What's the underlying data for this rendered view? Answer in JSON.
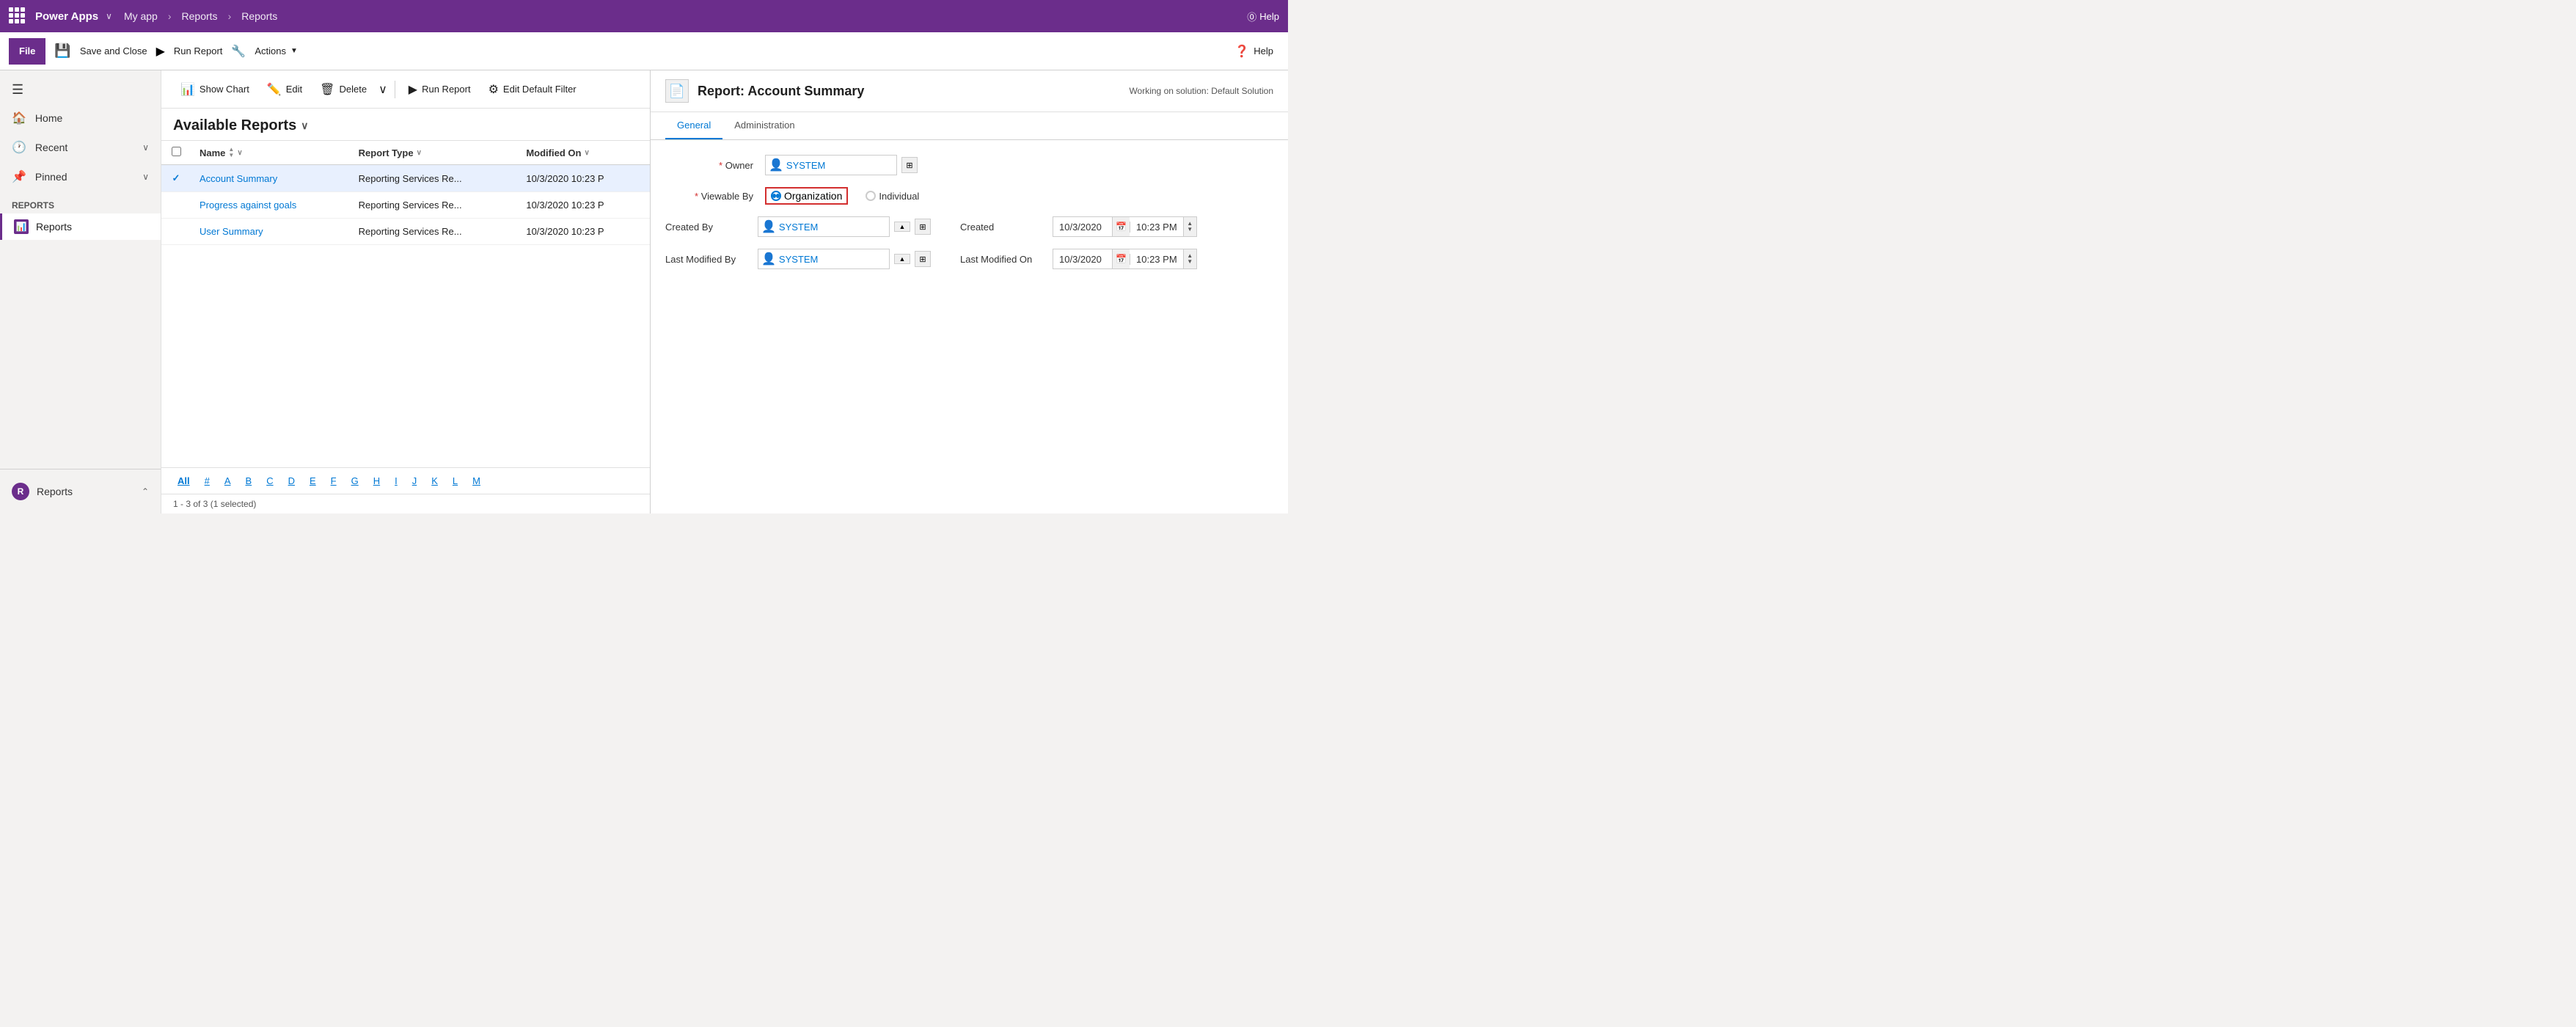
{
  "topnav": {
    "app_name": "Power Apps",
    "my_app": "My app",
    "breadcrumb1": "Reports",
    "breadcrumb2": "Reports",
    "help_label": "Help"
  },
  "ribbon": {
    "file_label": "File",
    "save_close_label": "Save and Close",
    "run_report_label": "Run Report",
    "actions_label": "Actions",
    "help_label": "Help"
  },
  "toolbar": {
    "show_chart_label": "Show Chart",
    "edit_label": "Edit",
    "delete_label": "Delete",
    "run_report_label": "Run Report",
    "edit_default_filter_label": "Edit Default Filter"
  },
  "sidebar": {
    "home_label": "Home",
    "recent_label": "Recent",
    "pinned_label": "Pinned",
    "section_label": "Reports",
    "reports_label": "Reports",
    "bottom_section": "Reports",
    "bottom_chevron": "⌃"
  },
  "list": {
    "title": "Available Reports",
    "columns": [
      {
        "label": "Name"
      },
      {
        "label": "Report Type"
      },
      {
        "label": "Modified On"
      }
    ],
    "rows": [
      {
        "name": "Account Summary",
        "type": "Reporting Services Re...",
        "modified": "10/3/2020 10:23 P",
        "selected": true
      },
      {
        "name": "Progress against goals",
        "type": "Reporting Services Re...",
        "modified": "10/3/2020 10:23 P",
        "selected": false
      },
      {
        "name": "User Summary",
        "type": "Reporting Services Re...",
        "modified": "10/3/2020 10:23 P",
        "selected": false
      }
    ],
    "alphabet": [
      "All",
      "#",
      "A",
      "B",
      "C",
      "D",
      "E",
      "F",
      "G",
      "H",
      "I",
      "J",
      "K",
      "L",
      "M"
    ],
    "status": "1 - 3 of 3 (1 selected)"
  },
  "right_panel": {
    "title": "Report: Account Summary",
    "working_on": "Working on solution: Default Solution",
    "tabs": [
      "General",
      "Administration"
    ],
    "active_tab": "General",
    "form": {
      "owner_label": "Owner",
      "owner_value": "SYSTEM",
      "viewable_by_label": "Viewable By",
      "org_label": "Organization",
      "individual_label": "Individual",
      "created_by_label": "Created By",
      "created_by_value": "SYSTEM",
      "last_modified_by_label": "Last Modified By",
      "last_modified_by_value": "SYSTEM",
      "created_on_label": "Created",
      "created_on_date": "10/3/2020",
      "created_on_time": "10:23 PM",
      "last_modified_on_label": "Last Modified On",
      "last_modified_on_date": "10/3/2020",
      "last_modified_on_time": "10:23 PM"
    }
  }
}
